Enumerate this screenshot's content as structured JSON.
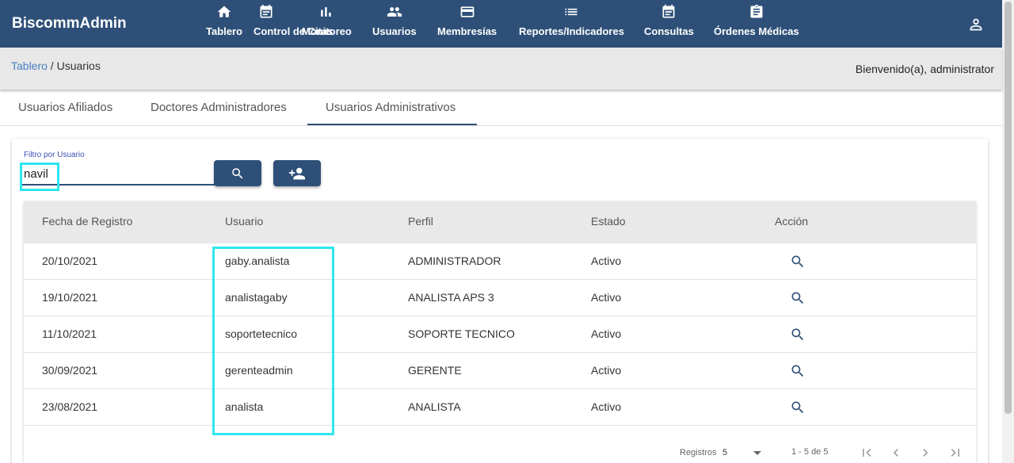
{
  "app": {
    "brand": "BiscommAdmin"
  },
  "nav": {
    "items": [
      {
        "label": "Tablero",
        "icon": "home-icon"
      },
      {
        "label": "Control de Citas",
        "icon": "calendar-icon"
      },
      {
        "label": "Monitoreo",
        "icon": "bar-chart-icon"
      },
      {
        "label": "Usuarios",
        "icon": "people-icon"
      },
      {
        "label": "Membresías",
        "icon": "card-icon"
      },
      {
        "label": "Reportes/Indicadores",
        "icon": "list-icon"
      },
      {
        "label": "Consultas",
        "icon": "calendar-icon"
      },
      {
        "label": "Órdenes Médicas",
        "icon": "clipboard-icon"
      }
    ],
    "account_icon": "person-icon"
  },
  "breadcrumb": {
    "root": "Tablero",
    "separator": " / ",
    "current": "Usuarios"
  },
  "welcome": "Bienvenido(a), administrator",
  "tabs": [
    {
      "label": "Usuarios Afiliados",
      "active": false
    },
    {
      "label": "Doctores Administradores",
      "active": false
    },
    {
      "label": "Usuarios Administrativos",
      "active": true
    }
  ],
  "filter": {
    "label": "Filtro por Usuario",
    "value": "navil",
    "search_icon": "search-icon",
    "add_icon": "add-user-icon"
  },
  "table": {
    "columns": [
      "Fecha de Registro",
      "Usuario",
      "Perfil",
      "Estado",
      "Acción"
    ],
    "rows": [
      {
        "fecha": "20/10/2021",
        "usuario": "gaby.analista",
        "perfil": "ADMINISTRADOR",
        "estado": "Activo"
      },
      {
        "fecha": "19/10/2021",
        "usuario": "analistagaby",
        "perfil": "ANALISTA APS 3",
        "estado": "Activo"
      },
      {
        "fecha": "11/10/2021",
        "usuario": "soportetecnico",
        "perfil": "SOPORTE TECNICO",
        "estado": "Activo"
      },
      {
        "fecha": "30/09/2021",
        "usuario": "gerenteadmin",
        "perfil": "GERENTE",
        "estado": "Activo"
      },
      {
        "fecha": "23/08/2021",
        "usuario": "analista",
        "perfil": "ANALISTA",
        "estado": "Activo"
      }
    ]
  },
  "paginator": {
    "label": "Registros",
    "page_size": "5",
    "range": "1 - 5 de 5"
  },
  "colors": {
    "primary": "#2e5078",
    "highlight": "#2ee6ee",
    "link": "#4a7fc4"
  }
}
